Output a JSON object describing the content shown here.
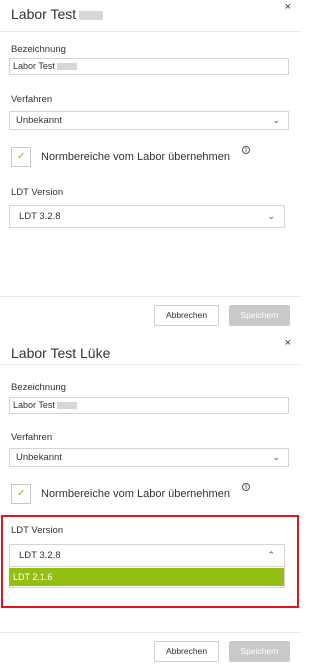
{
  "dialog1": {
    "title": "Labor Test",
    "close_symbol": "×",
    "bezeichnung_label": "Bezeichnung",
    "bezeichnung_value": "Labor Test",
    "verfahren_label": "Verfahren",
    "verfahren_value": "Unbekannt",
    "checkbox_label": "Normbereiche vom Labor übernehmen",
    "info_symbol": "i",
    "ldt_label": "LDT Version",
    "ldt_value": "LDT 3.2.8",
    "cancel_label": "Abbrechen",
    "save_label": "Speichern"
  },
  "dialog2": {
    "title": "Labor Test Lüke",
    "close_symbol": "×",
    "bezeichnung_label": "Bezeichnung",
    "bezeichnung_value": "Labor Test",
    "verfahren_label": "Verfahren",
    "verfahren_value": "Unbekannt",
    "checkbox_label": "Normbereiche vom Labor übernehmen",
    "info_symbol": "i",
    "ldt_label": "LDT Version",
    "ldt_value": "LDT 3.2.8",
    "ldt_options": [
      "LDT 2.1.6"
    ],
    "cancel_label": "Abbrechen",
    "save_label": "Speichern"
  },
  "colors": {
    "accent": "#93bf13",
    "highlight": "#e0141e",
    "disabled_button": "#c9c9c9"
  },
  "icons": {
    "close": "close-icon",
    "chevron_down": "chevron-down-icon",
    "chevron_up": "chevron-up-icon",
    "check": "check-icon",
    "info": "info-icon"
  }
}
